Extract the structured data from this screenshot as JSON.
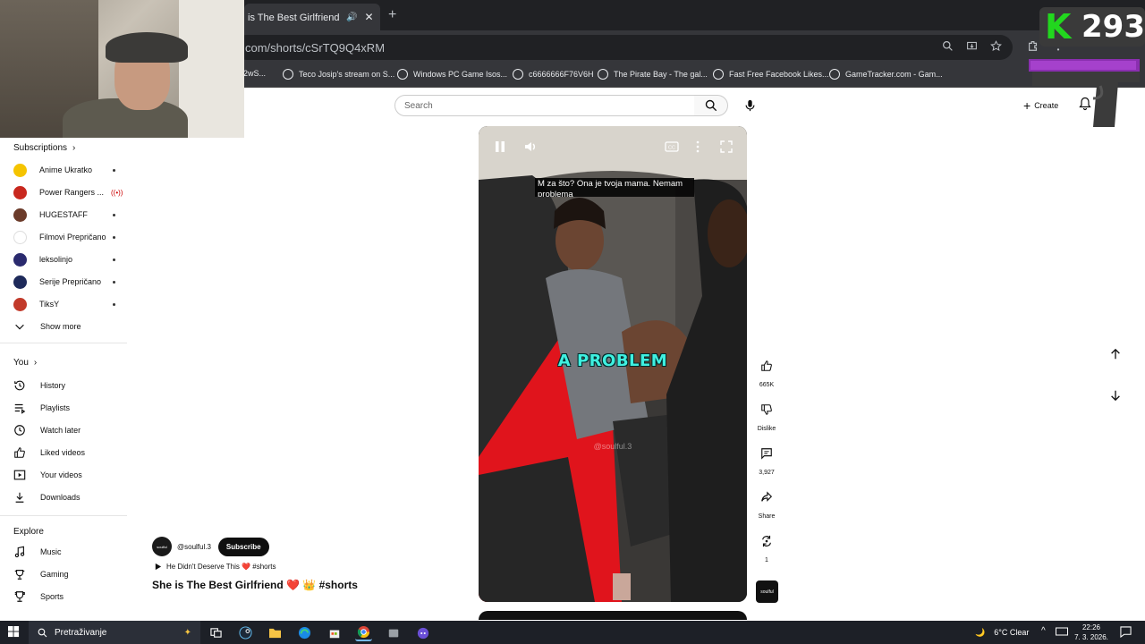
{
  "browser": {
    "tab_title": "is The Best Girlfriend ❤️ 👑 #s",
    "url": "com/shorts/cSrTQ9Q4xRM",
    "bookmarks": [
      {
        "label": "2wS..."
      },
      {
        "label": "Teco Josip's stream on S..."
      },
      {
        "label": "Windows PC Game Isos..."
      },
      {
        "label": "c6666666F76V6H"
      },
      {
        "label": "The Pirate Bay - The gal..."
      },
      {
        "label": "Fast Free Facebook Likes..."
      },
      {
        "label": "GameTracker.com - Gam..."
      }
    ]
  },
  "overlay": {
    "k_letter": "K",
    "counter": "293"
  },
  "masthead": {
    "search_placeholder": "Search",
    "create_label": "Create"
  },
  "sidebar": {
    "subscriptions_title": "Subscriptions",
    "subscriptions": [
      {
        "name": "Anime Ukratko",
        "color": "#f5c400",
        "live": false
      },
      {
        "name": "Power Rangers ...",
        "color": "#c8281e",
        "live": true
      },
      {
        "name": "HUGESTAFF",
        "color": "#6b3b2a",
        "live": false
      },
      {
        "name": "Filmovi Prepričano",
        "color": "#ffffff",
        "live": false
      },
      {
        "name": "leksolinjo",
        "color": "#2a2a6e",
        "live": false
      },
      {
        "name": "Serije Prepričano",
        "color": "#1e2a5a",
        "live": false
      },
      {
        "name": "TiksY",
        "color": "#c23a2a",
        "live": false
      }
    ],
    "show_more": "Show more",
    "you_title": "You",
    "you_items": [
      {
        "label": "History",
        "icon": "history-icon"
      },
      {
        "label": "Playlists",
        "icon": "playlists-icon"
      },
      {
        "label": "Watch later",
        "icon": "watch-later-icon"
      },
      {
        "label": "Liked videos",
        "icon": "liked-icon"
      },
      {
        "label": "Your videos",
        "icon": "your-videos-icon"
      },
      {
        "label": "Downloads",
        "icon": "downloads-icon"
      }
    ],
    "explore_title": "Explore",
    "explore_items": [
      {
        "label": "Music",
        "icon": "music-icon"
      },
      {
        "label": "Gaming",
        "icon": "gaming-icon"
      },
      {
        "label": "Sports",
        "icon": "sports-icon"
      }
    ]
  },
  "player": {
    "subtitle": "M za što?  Ona je tvoja mama.  Nemam problema",
    "caption": "A PROBLEM",
    "watermark": "@soulful.3"
  },
  "actions": {
    "likes": "665K",
    "dislike": "Dislike",
    "comments": "3,927",
    "share": "Share",
    "remix": "1",
    "channel_thumb": "soulful"
  },
  "video_meta": {
    "avatar_text": "soulful",
    "channel": "@soulful.3",
    "subscribe": "Subscribe",
    "sound": "He Didn't Deserve This ❤️ #shorts",
    "title": "She is The Best Girlfriend ❤️ 👑 #shorts"
  },
  "taskbar": {
    "search_placeholder": "Pretraživanje",
    "weather": "6°C  Clear",
    "time": "22:26",
    "date": "7. 3. 2026."
  }
}
